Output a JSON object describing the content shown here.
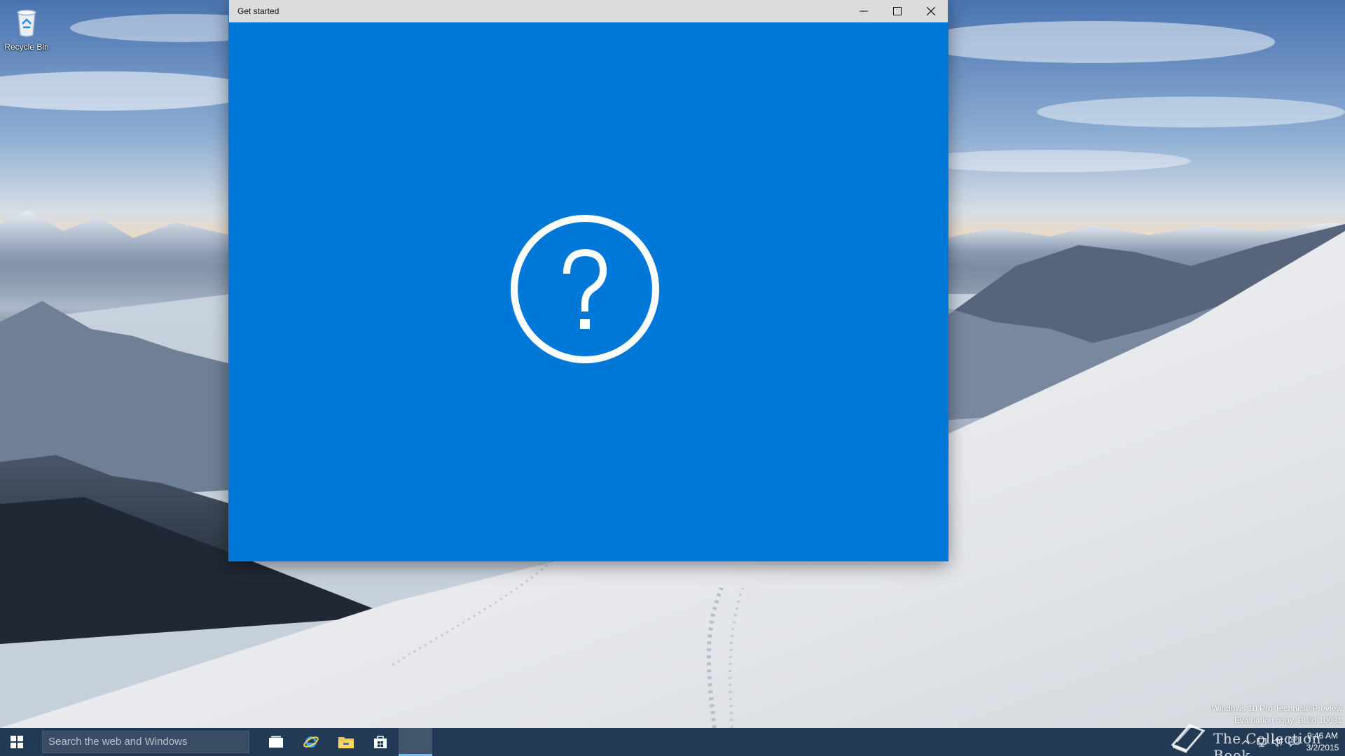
{
  "desktop": {
    "icons": [
      {
        "label": "Recycle Bin",
        "icon": "recycle-bin-icon"
      }
    ]
  },
  "window": {
    "title": "Get started",
    "controls": {
      "minimize": "minimize-icon",
      "maximize": "maximize-icon",
      "close": "close-icon"
    },
    "content": {
      "icon": "help-circle-icon",
      "background": "#0078d7"
    }
  },
  "taskbar": {
    "search_placeholder": "Search the web and Windows",
    "apps": [
      {
        "name": "Task View",
        "icon": "task-view-icon"
      },
      {
        "name": "Internet Explorer",
        "icon": "internet-explorer-icon"
      },
      {
        "name": "File Explorer",
        "icon": "file-explorer-icon"
      },
      {
        "name": "Store",
        "icon": "store-icon"
      },
      {
        "name": "Get started",
        "icon": "get-started-icon",
        "active": true
      }
    ],
    "tray": {
      "time": "9:46 AM",
      "date": "3/2/2015"
    }
  },
  "watermark": {
    "line1": "Windows 10 Pro Technical Preview",
    "line2": "Evaluation copy. Build 10031"
  },
  "brand": {
    "text": "The Collection Book"
  },
  "colors": {
    "accent": "#0078d7",
    "titlebar": "#dcdcdc",
    "taskbar": "#142c48"
  }
}
